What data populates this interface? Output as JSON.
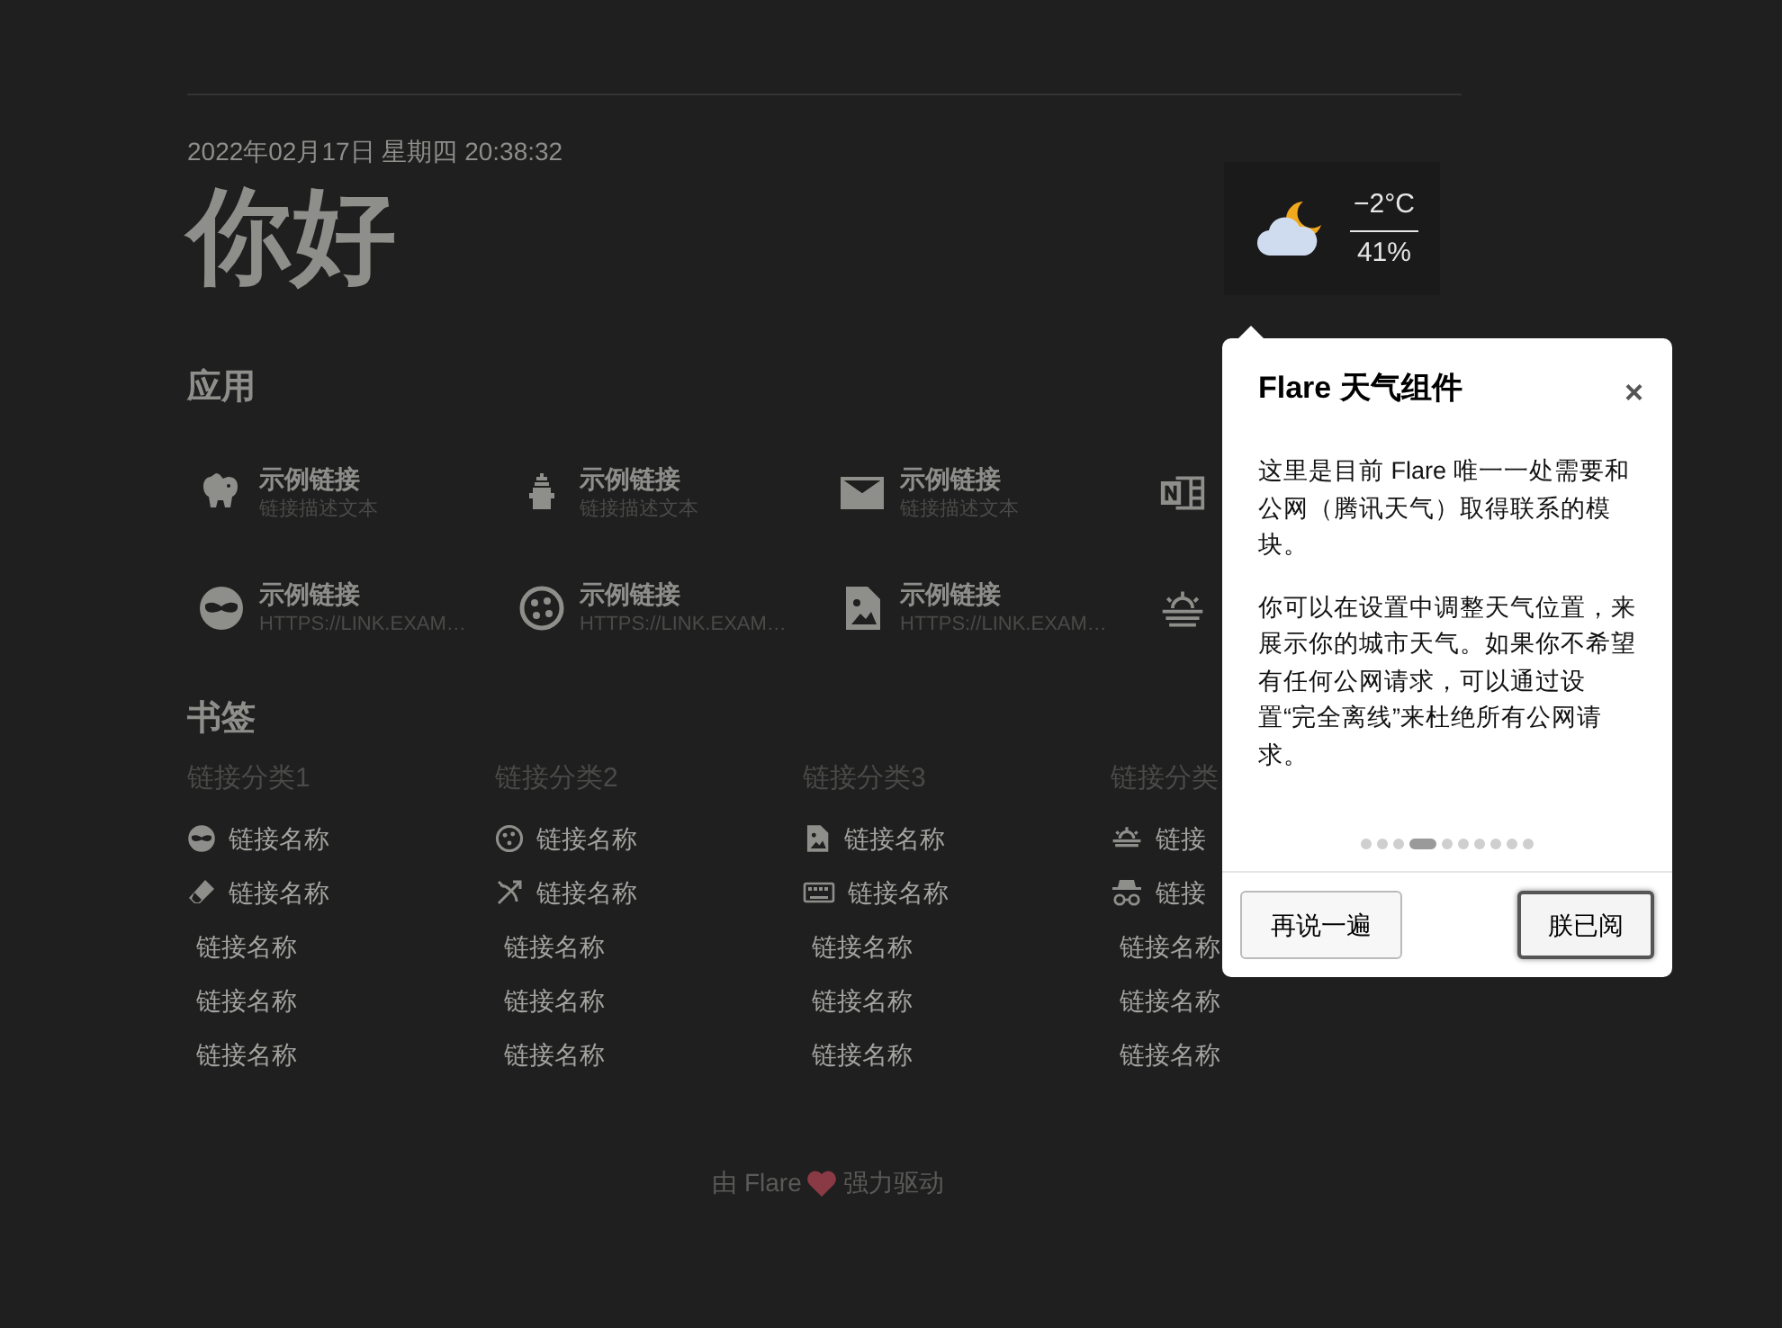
{
  "date": "2022年02月17日 星期四 20:38:32",
  "greeting": "你好",
  "weather": {
    "temperature": "−2°C",
    "humidity": "41%"
  },
  "apps": {
    "title": "应用",
    "items": [
      {
        "kind": "link",
        "title": "示例链接",
        "subtitle": "链接描述文本"
      },
      {
        "kind": "link",
        "title": "示例链接",
        "subtitle": "链接描述文本"
      },
      {
        "kind": "link",
        "title": "示例链接",
        "subtitle": "链接描述文本"
      },
      {
        "kind": "icon_only"
      },
      {
        "kind": "link",
        "title": "示例链接",
        "subtitle": "HTTPS://LINK.EXAM…"
      },
      {
        "kind": "link",
        "title": "示例链接",
        "subtitle": "HTTPS://LINK.EXAM…"
      },
      {
        "kind": "link",
        "title": "示例链接",
        "subtitle": "HTTPS://LINK.EXAM…"
      },
      {
        "kind": "icon_only"
      }
    ]
  },
  "bookmarks": {
    "title": "书签",
    "categories": [
      {
        "name": "链接分类1",
        "links": [
          {
            "kind": "icon",
            "label": "链接名称"
          },
          {
            "kind": "icon",
            "label": "链接名称"
          },
          {
            "kind": "plain",
            "label": "链接名称"
          },
          {
            "kind": "plain",
            "label": "链接名称"
          },
          {
            "kind": "plain",
            "label": "链接名称"
          }
        ]
      },
      {
        "name": "链接分类2",
        "links": [
          {
            "kind": "icon",
            "label": "链接名称"
          },
          {
            "kind": "icon",
            "label": "链接名称"
          },
          {
            "kind": "plain",
            "label": "链接名称"
          },
          {
            "kind": "plain",
            "label": "链接名称"
          },
          {
            "kind": "plain",
            "label": "链接名称"
          }
        ]
      },
      {
        "name": "链接分类3",
        "links": [
          {
            "kind": "icon",
            "label": "链接名称"
          },
          {
            "kind": "icon",
            "label": "链接名称"
          },
          {
            "kind": "plain",
            "label": "链接名称"
          },
          {
            "kind": "plain",
            "label": "链接名称"
          },
          {
            "kind": "plain",
            "label": "链接名称"
          }
        ]
      },
      {
        "name": "链接分类",
        "links": [
          {
            "kind": "icon",
            "label": "链接"
          },
          {
            "kind": "icon",
            "label": "链接"
          },
          {
            "kind": "plain",
            "label": "链接名称"
          },
          {
            "kind": "plain",
            "label": "链接名称"
          },
          {
            "kind": "plain",
            "label": "链接名称"
          }
        ]
      }
    ]
  },
  "popup": {
    "title": "Flare 天气组件",
    "close": "×",
    "paragraphs": [
      "这里是目前 Flare 唯一一处需要和公网（腾讯天气）取得联系的模块。",
      "你可以在设置中调整天气位置，来展示你的城市天气。如果你不希望有任何公网请求，可以通过设置“完全离线”来杜绝所有公网请求。"
    ],
    "steps": [
      {
        "selected": false
      },
      {
        "selected": false
      },
      {
        "selected": false
      },
      {
        "selected": true
      },
      {
        "selected": false
      },
      {
        "selected": false
      },
      {
        "selected": false
      },
      {
        "selected": false
      },
      {
        "selected": false
      },
      {
        "selected": false
      }
    ],
    "buttons": [
      {
        "label": "再说一遍",
        "focused": false
      },
      {
        "label": "朕已阅",
        "focused": true
      }
    ]
  },
  "footer": {
    "before": "由 Flare",
    "after": "强力驱动"
  }
}
